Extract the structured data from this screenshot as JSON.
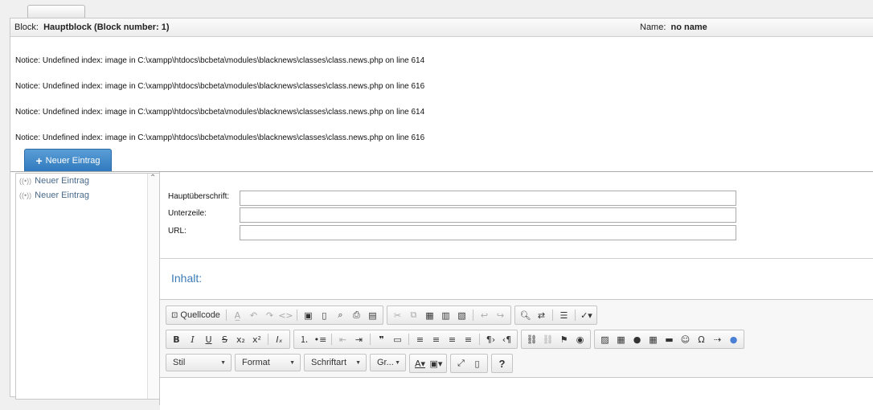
{
  "block": {
    "block_label": "Block:",
    "block_value": "Hauptblock (Block number: 1)",
    "name_label": "Name:",
    "name_value": "no name"
  },
  "notices": [
    "Notice: Undefined index: image in C:\\xampp\\htdocs\\bcbeta\\modules\\blacknews\\classes\\class.news.php on line 614",
    "Notice: Undefined index: image in C:\\xampp\\htdocs\\bcbeta\\modules\\blacknews\\classes\\class.news.php on line 616",
    "Notice: Undefined index: image in C:\\xampp\\htdocs\\bcbeta\\modules\\blacknews\\classes\\class.news.php on line 614",
    "Notice: Undefined index: image in C:\\xampp\\htdocs\\bcbeta\\modules\\blacknews\\classes\\class.news.php on line 616"
  ],
  "new_entry_button": {
    "label": "Neuer Eintrag",
    "icon": "plus-icon"
  },
  "sidebar": {
    "items": [
      {
        "label": "Neuer Eintrag",
        "icon": "broadcast-icon"
      },
      {
        "label": "Neuer Eintrag",
        "icon": "broadcast-icon"
      }
    ]
  },
  "form": {
    "headline_label": "Hauptüberschrift:",
    "headline_value": "",
    "subline_label": "Unterzeile:",
    "subline_value": "",
    "url_label": "URL:",
    "url_value": ""
  },
  "content": {
    "label": "Inhalt:"
  },
  "editor": {
    "source_label": "Quellcode",
    "combos": {
      "style": "Stil",
      "format": "Format",
      "font": "Schriftart",
      "size": "Gr..."
    },
    "help": "?"
  }
}
